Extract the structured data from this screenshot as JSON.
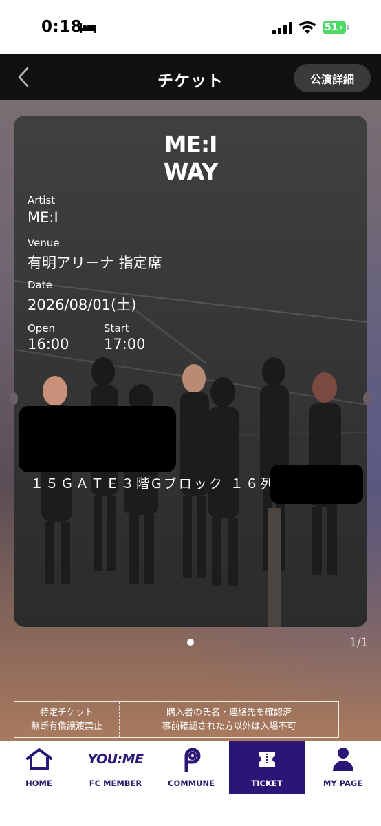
{
  "status_bar": {
    "time": "0:18",
    "battery": "51"
  },
  "nav": {
    "title": "チケット",
    "detail_button": "公演詳細"
  },
  "ticket": {
    "logo_line1": "ME:I",
    "logo_line2": "WAY",
    "artist_label": "Artist",
    "artist_value": "ME:I",
    "venue_label": "Venue",
    "venue_value": "有明アリーナ 指定席",
    "date_label": "Date",
    "date_value": "2026/08/01(土)",
    "open_label": "Open",
    "open_value": "16:00",
    "start_label": "Start",
    "start_value": "17:00",
    "seat_text": "１５ＧＡＴＥ３階Gブロック １６列",
    "emoji_large": "😌😌😌",
    "emoji_small": "😌😌😌"
  },
  "pager": {
    "count": "1/1"
  },
  "notice": {
    "left_line1": "特定チケット",
    "left_line2": "無断有償譲渡禁止",
    "right_line1": "購入者の氏名・連絡先を確認済",
    "right_line2": "事前確認された方以外は入場不可"
  },
  "tabs": [
    {
      "label": "HOME",
      "icon": "home-icon"
    },
    {
      "label": "FC MEMBER",
      "icon": "youme-logo-icon",
      "logo_text": "YOU:ME"
    },
    {
      "label": "COMMUNE",
      "icon": "commune-icon"
    },
    {
      "label": "TICKET",
      "icon": "ticket-icon",
      "active": true
    },
    {
      "label": "MY PAGE",
      "icon": "person-icon"
    }
  ],
  "colors": {
    "accent": "#2b1577",
    "nav_bg": "#111111",
    "battery_green": "#4cd964"
  }
}
